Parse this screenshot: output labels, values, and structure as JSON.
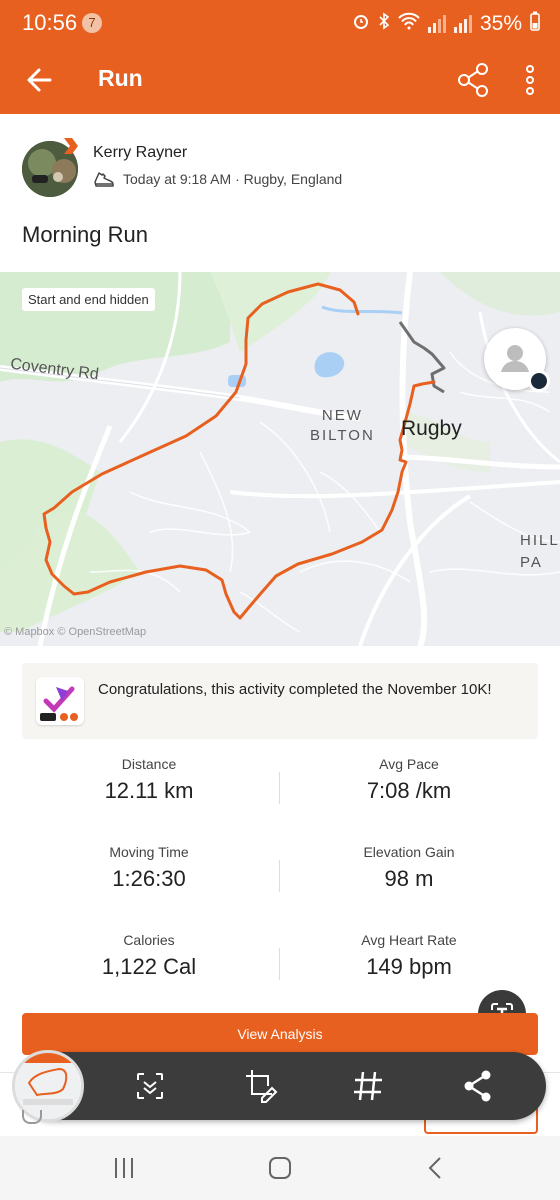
{
  "status_bar": {
    "time": "10:56",
    "notification_count": "7",
    "battery": "35%"
  },
  "app_bar": {
    "title": "Run",
    "back_icon": "arrow-left-icon",
    "share_icon": "share-icon",
    "more_icon": "more-vertical-icon"
  },
  "athlete": {
    "name": "Kerry Rayner",
    "meta": "Today at 9:18 AM · Rugby, England"
  },
  "activity": {
    "title": "Morning Run"
  },
  "map": {
    "chip": "Start and end hidden",
    "labels": {
      "coventry": "Coventry Rd",
      "new": "NEW",
      "bilton": "BILTON",
      "rugby": "Rugby",
      "hill": "HILL",
      "pa": "PA"
    },
    "attribution": "© Mapbox © OpenStreetMap"
  },
  "challenge": {
    "text": "Congratulations, this activity completed the November 10K!"
  },
  "stats": [
    {
      "left_label": "Distance",
      "left_value": "12.11 km",
      "right_label": "Avg Pace",
      "right_value": "7:08 /km"
    },
    {
      "left_label": "Moving Time",
      "left_value": "1:26:30",
      "right_label": "Elevation Gain",
      "right_value": "98 m"
    },
    {
      "left_label": "Calories",
      "left_value": "1,122 Cal",
      "right_label": "Avg Heart Rate",
      "right_value": "149 bpm"
    }
  ],
  "actions": {
    "view_analysis": "View Analysis"
  },
  "toolbar": {
    "icons": [
      "scan-text-icon",
      "crop-edit-icon",
      "hashtag-icon",
      "share-icon"
    ]
  },
  "colors": {
    "brand": "#e8601f",
    "route": "#e8601f",
    "route_hidden": "#6f6f6f"
  }
}
